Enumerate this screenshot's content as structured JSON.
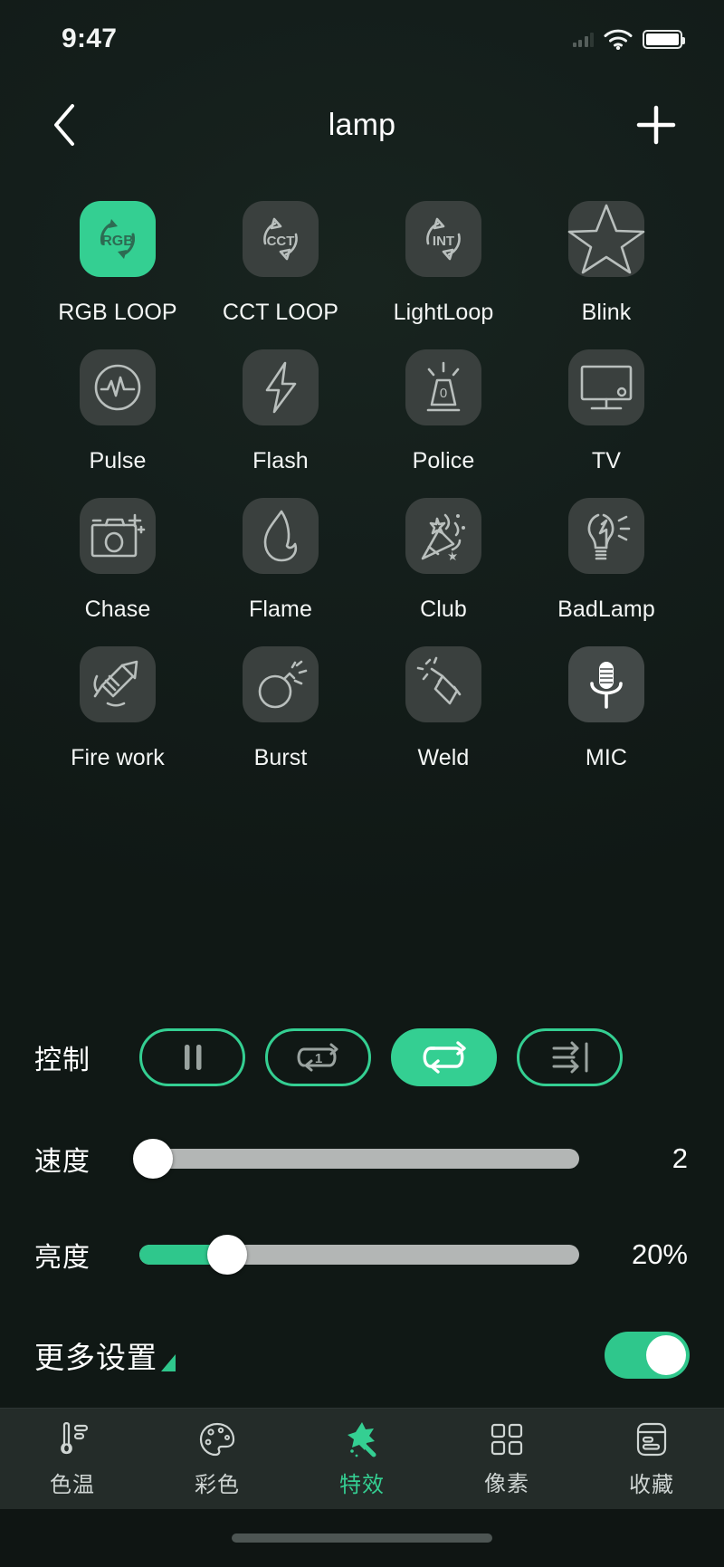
{
  "status_bar": {
    "time": "9:47",
    "wifi_icon": "wifi-icon",
    "battery_icon": "battery-icon"
  },
  "nav": {
    "back_icon": "chevron-left-icon",
    "title": "lamp",
    "add_icon": "plus-icon"
  },
  "effects": {
    "items": [
      {
        "label": "RGB LOOP",
        "icon": "rgb-loop-icon",
        "selected": true,
        "highlighted": false
      },
      {
        "label": "CCT LOOP",
        "icon": "cct-loop-icon",
        "selected": false,
        "highlighted": false
      },
      {
        "label": "LightLoop",
        "icon": "int-loop-icon",
        "selected": false,
        "highlighted": false
      },
      {
        "label": "Blink",
        "icon": "star-icon",
        "selected": false,
        "highlighted": false
      },
      {
        "label": "Pulse",
        "icon": "pulse-icon",
        "selected": false,
        "highlighted": false
      },
      {
        "label": "Flash",
        "icon": "lightning-icon",
        "selected": false,
        "highlighted": false
      },
      {
        "label": "Police",
        "icon": "siren-icon",
        "selected": false,
        "highlighted": false
      },
      {
        "label": "TV",
        "icon": "tv-icon",
        "selected": false,
        "highlighted": false
      },
      {
        "label": "Chase",
        "icon": "camera-icon",
        "selected": false,
        "highlighted": false
      },
      {
        "label": "Flame",
        "icon": "flame-icon",
        "selected": false,
        "highlighted": false
      },
      {
        "label": "Club",
        "icon": "party-popper-icon",
        "selected": false,
        "highlighted": false
      },
      {
        "label": "BadLamp",
        "icon": "broken-bulb-icon",
        "selected": false,
        "highlighted": false
      },
      {
        "label": "Fire work",
        "icon": "firework-rocket-icon",
        "selected": false,
        "highlighted": false
      },
      {
        "label": "Burst",
        "icon": "bomb-icon",
        "selected": false,
        "highlighted": false
      },
      {
        "label": "Weld",
        "icon": "welding-torch-icon",
        "selected": false,
        "highlighted": false
      },
      {
        "label": "MIC",
        "icon": "microphone-icon",
        "selected": false,
        "highlighted": true
      }
    ]
  },
  "control": {
    "label": "控制",
    "buttons": [
      {
        "name": "pause",
        "icon": "pause-icon",
        "active": false
      },
      {
        "name": "repeat-one",
        "icon": "repeat-one-icon",
        "active": false
      },
      {
        "name": "repeat-all",
        "icon": "repeat-all-icon",
        "active": true
      },
      {
        "name": "play-to-end",
        "icon": "play-to-end-icon",
        "active": false
      }
    ]
  },
  "speed": {
    "label": "速度",
    "value_text": "2",
    "percent": 3
  },
  "brightness": {
    "label": "亮度",
    "value_text": "20%",
    "percent": 20
  },
  "more_settings": {
    "label": "更多设置",
    "caret_icon": "triangle-expand-icon",
    "toggle_on": true
  },
  "tabs": [
    {
      "label": "色温",
      "icon": "thermometer-icon",
      "active": false
    },
    {
      "label": "彩色",
      "icon": "palette-icon",
      "active": false
    },
    {
      "label": "特效",
      "icon": "magic-wand-icon",
      "active": true
    },
    {
      "label": "像素",
      "icon": "grid-squares-icon",
      "active": false
    },
    {
      "label": "收藏",
      "icon": "archive-box-icon",
      "active": false
    }
  ],
  "colors": {
    "accent_green": "#34cf92",
    "background": "#141e1b",
    "tile": "#3a403e",
    "tab_bar": "#242c29",
    "slider_track": "#b3b6b5"
  }
}
